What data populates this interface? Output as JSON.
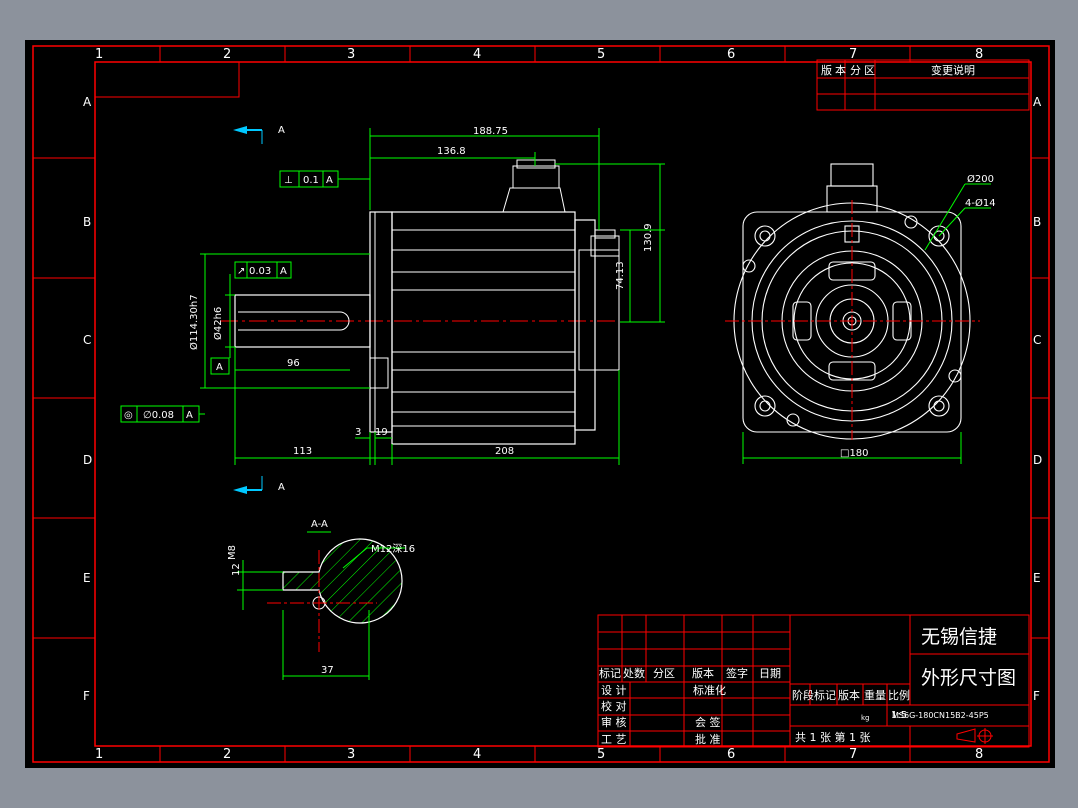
{
  "colors": {
    "background": "#000000",
    "frame": "#ff0000",
    "geometry": "#ffffff",
    "dimension": "#00ff00",
    "text_white": "#ffffff",
    "center_line": "#ff0000",
    "hatch": "#00ff00",
    "border_line": "#ff0000",
    "view_arrow": "#00c8ff"
  },
  "grid": {
    "columns": [
      "1",
      "2",
      "3",
      "4",
      "5",
      "6",
      "7",
      "8"
    ],
    "rows": [
      "A",
      "B",
      "C",
      "D",
      "E",
      "F"
    ]
  },
  "revision_table": {
    "headers": [
      "版",
      "本",
      "分",
      "区",
      "变更说明"
    ]
  },
  "dimensions": {
    "overall_length": "188.75",
    "connector_distance": "136.8",
    "height_total": "130.9",
    "connector_height": "74.13",
    "shaft_length": "113",
    "body_length": "208",
    "flange_thickness": "3",
    "spigot_depth": "19",
    "key_length": "96",
    "spigot_diameter": "Ø114.30h7",
    "shaft_diameter": "Ø42h6",
    "flange_square": "□180",
    "pcd": "Ø200",
    "mounting_holes": "4-Ø14",
    "key_width": "12",
    "key_depth": "37",
    "thread": "M12深16",
    "thread_label_alt": "M8"
  },
  "tolerances": {
    "perpendicularity": {
      "symbol": "⊥",
      "value": "0.1",
      "datum": "A"
    },
    "runout": {
      "symbol": "↗",
      "value": "0.03",
      "datum": "A"
    },
    "concentricity": {
      "symbol": "◎",
      "value": "∅0.08",
      "datum": "A"
    },
    "datum_label": "A"
  },
  "section": {
    "label": "A-A",
    "view_label_top": "A",
    "view_label_bottom": "A"
  },
  "title_block": {
    "company": "无锡信捷",
    "drawing_title": "外形尺寸图",
    "model": "MS6G-180CN15B2-45P5",
    "scale": "1:5",
    "scale_label": "比例",
    "weight_label": "重量",
    "stage_label": "阶段标记",
    "version_label": "版本",
    "sheet_text": "共 1 张 第 1 张",
    "row_labels": [
      "标记",
      "处数",
      "分区",
      "版本",
      "签字",
      "日期"
    ],
    "left_labels": [
      "设 计",
      "校 对",
      "审 核",
      "工 艺"
    ],
    "mid_labels": [
      "标准化",
      "会 签",
      "批 准"
    ],
    "kg_label": "kg"
  }
}
